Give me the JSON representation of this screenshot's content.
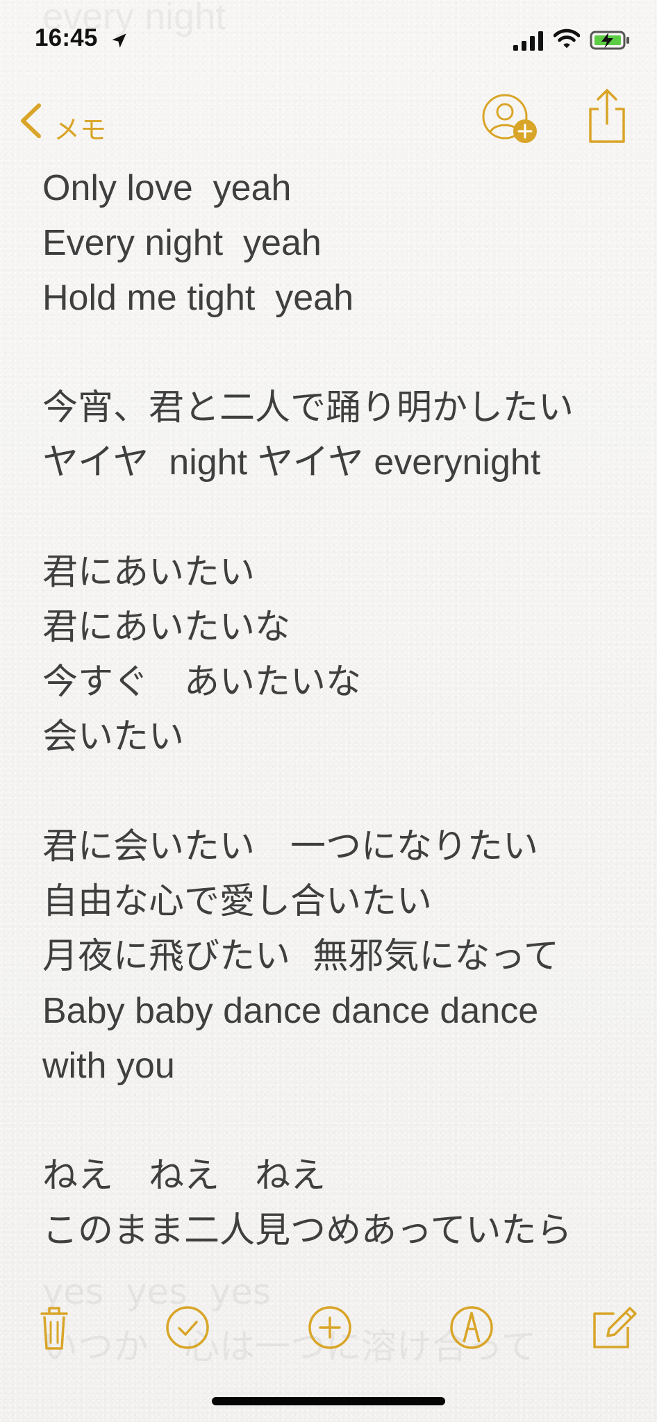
{
  "status_bar": {
    "time": "16:45",
    "location_icon": "location-arrow-icon",
    "signal_icon": "cellular-signal-icon",
    "wifi_icon": "wifi-icon",
    "battery_icon": "charging-battery-icon",
    "battery_color": "#5dcc45"
  },
  "navigation": {
    "back_label": "メモ",
    "back_icon": "chevron-left-icon",
    "collaborate_icon": "add-person-icon",
    "share_icon": "share-icon",
    "accent_color": "#d9a528"
  },
  "note": {
    "top_faded_text": "every night",
    "lines": [
      "Only love  yeah",
      "Every night  yeah",
      "Hold me tight  yeah",
      "",
      "今宵、君と二人で踊り明かしたい",
      "ヤイヤ  night ヤイヤ everynight",
      "",
      "君にあいたい",
      "君にあいたいな",
      "今すぐ　あいたいな",
      "会いたい",
      "",
      "君に会いたい　一つになりたい",
      "自由な心で愛し合いたい",
      "月夜に飛びたい  無邪気になって",
      "Baby baby dance dance dance",
      "with you",
      "",
      "ねえ　ねえ　ねえ",
      "このまま二人見つめあっていたら"
    ],
    "bottom_faded_lines": [
      "yes  yes  yes",
      "いつか　心は一つに溶け合って"
    ]
  },
  "toolbar": {
    "delete_icon": "trash-icon",
    "checklist_icon": "checklist-icon",
    "add_icon": "add-icon",
    "markup_icon": "markup-pen-icon",
    "compose_icon": "compose-icon"
  }
}
